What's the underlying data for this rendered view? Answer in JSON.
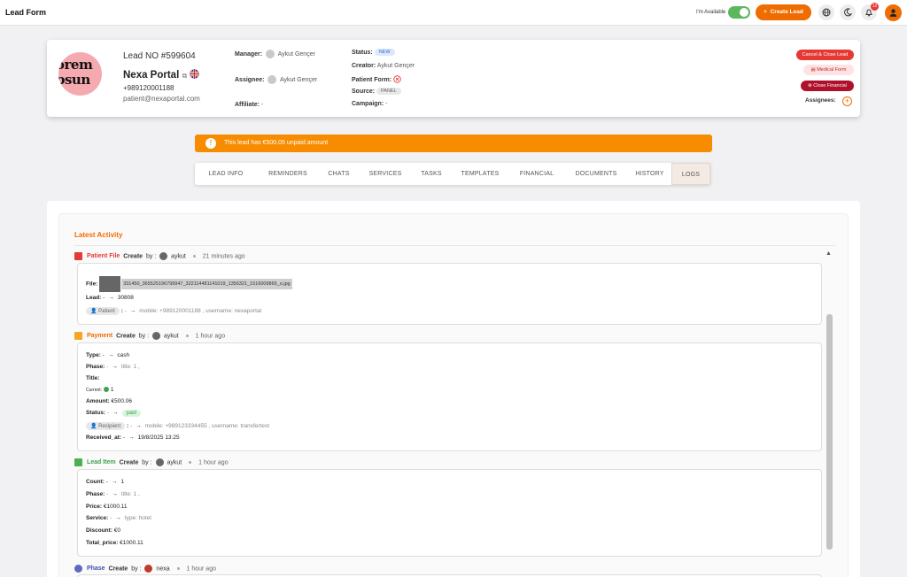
{
  "topbar": {
    "title": "Lead Form",
    "availability_label": "I'm Available",
    "create_lead_label": "Create Lead",
    "notification_count": "12"
  },
  "lead": {
    "avatar_text_top": "orem",
    "avatar_text_bottom": "psun",
    "lead_no": "Lead NO #599604",
    "name": "Nexa Portal",
    "phone": "+989120001188",
    "email": "patient@nexaportal.com",
    "manager_label": "Manager:",
    "manager_value": "Aykut Gençer",
    "assignee_label": "Assignee:",
    "assignee_value": "Aykut Gençer",
    "affiliate_label": "Affiliate:",
    "affiliate_value": "-",
    "status_label": "Status:",
    "status_value": "NEW",
    "creator_label": "Creator:",
    "creator_value": "Aykut Gençer",
    "patient_form_label": "Patient Form:",
    "source_label": "Source:",
    "source_value": "PANEL",
    "campaign_label": "Campaign:",
    "campaign_value": "-",
    "cancel_close_label": "Cancel & Close Lead",
    "medical_form_label": "Medical Form",
    "close_financial_label": "Close Financial",
    "assignees_label": "Assignees:"
  },
  "alert": {
    "text": "This lead has €500.05 unpaid amount"
  },
  "tabs": [
    "LEAD INFO",
    "REMINDERS",
    "CHATS",
    "SERVICES",
    "TASKS",
    "TEMPLATES",
    "FINANCIAL",
    "DOCUMENTS",
    "HISTORY",
    "LOGS"
  ],
  "activity": {
    "title": "Latest Activity",
    "a1": {
      "type": "Patient File",
      "action": "Create",
      "by": "by :",
      "user": "aykut",
      "time": "21 minutes ago",
      "file_label": "File:",
      "file_name": "331450_365525196799947_322114481141019_1356321_1516009865_o.jpg",
      "lead_label": "Lead:",
      "lead_from": "-",
      "lead_to": "30808",
      "patient_chip": "Patient",
      "colon": ":",
      "patient_from": "-",
      "patient_detail": "mobile: +989120001188 , username: nexaportal"
    },
    "a2": {
      "type": "Payment",
      "action": "Create",
      "by": "by :",
      "user": "aykut",
      "time": "1 hour ago",
      "type_label": "Type:",
      "type_from": "-",
      "type_to": "cash",
      "phase_label": "Phase:",
      "phase_from": "-",
      "phase_to": "title: 1 ,",
      "title_label": "Title:",
      "current_label": "Current:",
      "current_value": "1",
      "amount_label": "Amount:",
      "amount_value": "€500.06",
      "status_label": "Status:",
      "status_from": "-",
      "status_to": "paid",
      "recipient_chip": "Recipient",
      "colon": ":",
      "recipient_from": "-",
      "recipient_detail": "mobile: +989123334455 , username: transfertest",
      "received_label": "Received_at:",
      "received_from": "-",
      "received_to": "19/8/2025 13:25"
    },
    "a3": {
      "type": "Lead Item",
      "action": "Create",
      "by": "by :",
      "user": "aykut",
      "time": "1 hour ago",
      "count_label": "Count:",
      "count_from": "-",
      "count_to": "1",
      "phase_label": "Phase:",
      "phase_from": "-",
      "phase_to": "title: 1 ,",
      "price_label": "Price:",
      "price_value": "€1000.11",
      "service_label": "Service:",
      "service_from": "-",
      "service_to": "type: hotel",
      "discount_label": "Discount:",
      "discount_value": "€0",
      "total_label": "Total_price:",
      "total_value": "€1000.11"
    },
    "a4": {
      "type": "Phase",
      "action": "Create",
      "by": "by :",
      "user": "nexa",
      "time": "1 hour ago"
    }
  },
  "colors": {
    "accent": "#ef6c00",
    "alert": "#f78c00",
    "danger": "#e53935",
    "success": "#3ea34f"
  }
}
